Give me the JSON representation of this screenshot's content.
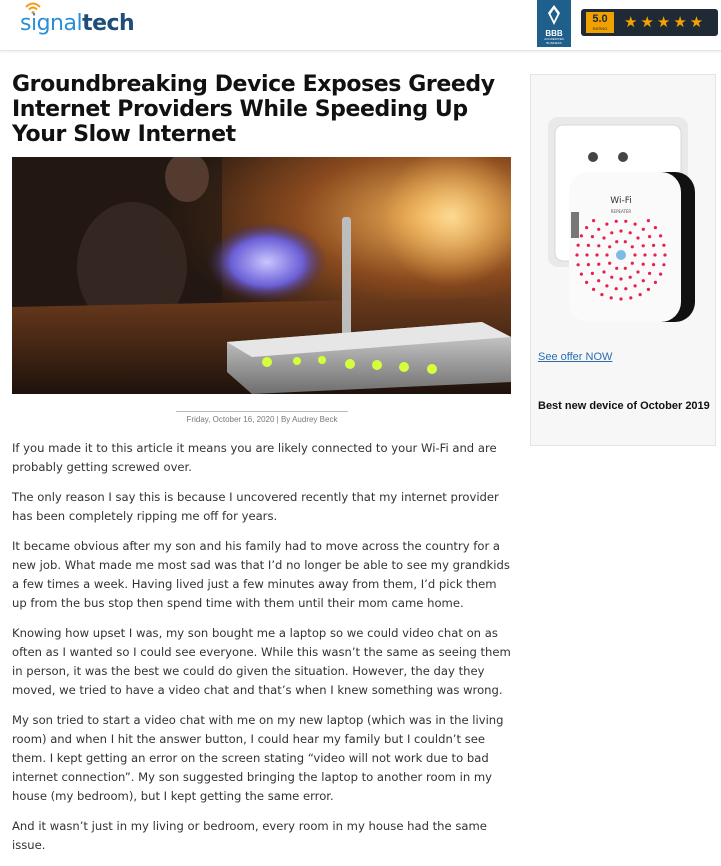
{
  "header": {
    "brand_part1": "signal",
    "brand_part2": "tech",
    "bbb_label": "BBB",
    "bbb_sub": "ACCREDITED BUSINESS",
    "rating_value": "5.0",
    "rating_label": "RATING",
    "stars": "★★★★★"
  },
  "article": {
    "title": "Groundbreaking Device Exposes Greedy Internet Providers While Speeding Up Your Slow Internet",
    "byline": "Friday, October 16, 2020 | By Audrey Beck",
    "paragraphs": [
      "If you made it to this article it means you are likely connected to your Wi-Fi and are probably getting screwed over.",
      "The only reason I say this is because I uncovered recently that my internet provider has been completely ripping me off for years.",
      "It became obvious after my son and his family had to move across the country for a new job. What made me most sad was that I’d no longer be able to see my grandkids a few times a week. Having lived just a few minutes away from them, I’d pick them up from the bus stop then spend time with them until their mom came home.",
      "Knowing how upset I was, my son bought me a laptop so we could video chat on as often as I wanted so I could see everyone. While this wasn’t the same as seeing them in person, it was the best we could do given the situation. However, the day they moved, we tried to have a video chat and that’s when I knew something was wrong.",
      "My son tried to start a video chat with me on my new laptop (which was in the living room) and when I hit the answer button, I could hear my family but I couldn’t see them. I kept getting an error on the screen stating “video will not work due to bad internet connection”. My son suggested bringing the laptop to another room in my house (my bedroom), but I kept getting the same error.",
      "And it wasn’t just in my living or bedroom, every room in my house had the same issue."
    ]
  },
  "sidebar": {
    "device_label": "Wi-Fi",
    "device_sublabel": "REPEATER",
    "offer_link": "See offer NOW",
    "caption": "Best new device of October 2019"
  },
  "colors": {
    "brand_blue": "#2a8fd6",
    "brand_dark": "#1f4e7a",
    "wifi_orange": "#f39c12",
    "bbb_blue": "#1f5f8b",
    "star_gold": "#f0a500",
    "link_blue": "#2b6cb0"
  },
  "icons": [
    "wifi-icon",
    "bbb-torch-icon",
    "star-icon"
  ]
}
